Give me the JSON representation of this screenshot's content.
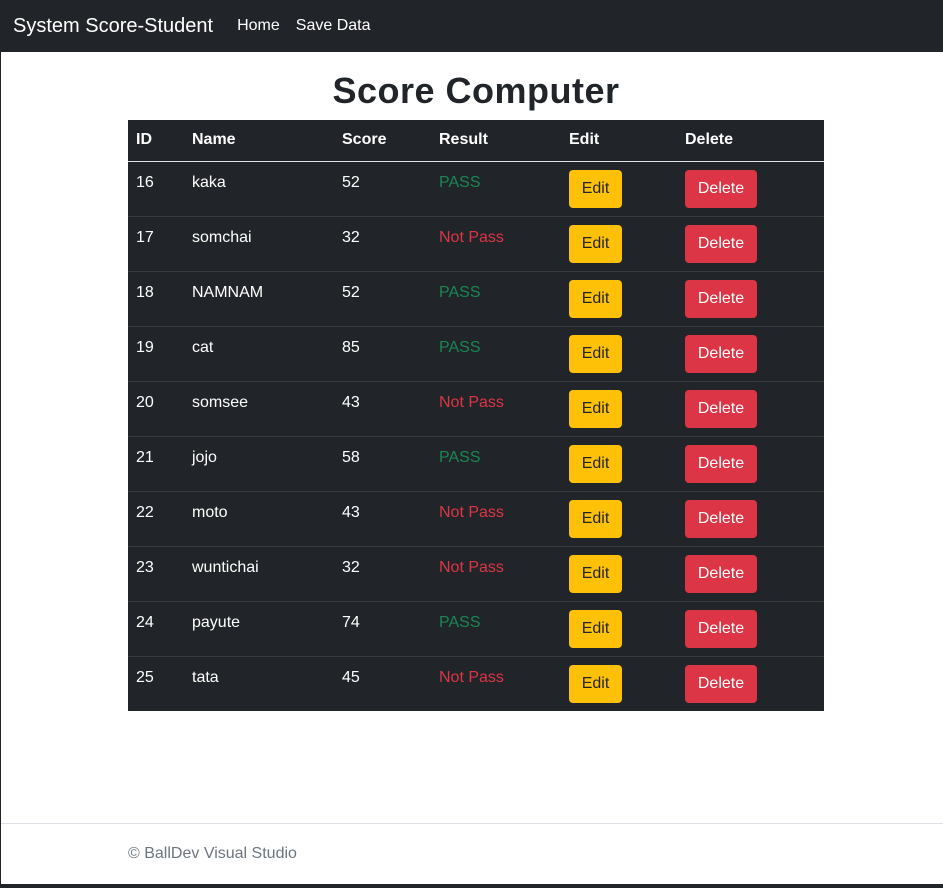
{
  "navbar": {
    "brand": "System Score-Student",
    "links": [
      "Home",
      "Save Data"
    ]
  },
  "page_title": "Score Computer",
  "table": {
    "headers": [
      "ID",
      "Name",
      "Score",
      "Result",
      "Edit",
      "Delete"
    ],
    "rows": [
      {
        "id": "16",
        "name": "kaka",
        "score": "52",
        "result": "PASS",
        "pass": true
      },
      {
        "id": "17",
        "name": "somchai",
        "score": "32",
        "result": "Not Pass",
        "pass": false
      },
      {
        "id": "18",
        "name": "NAMNAM",
        "score": "52",
        "result": "PASS",
        "pass": true
      },
      {
        "id": "19",
        "name": "cat",
        "score": "85",
        "result": "PASS",
        "pass": true
      },
      {
        "id": "20",
        "name": "somsee",
        "score": "43",
        "result": "Not Pass",
        "pass": false
      },
      {
        "id": "21",
        "name": "jojo",
        "score": "58",
        "result": "PASS",
        "pass": true
      },
      {
        "id": "22",
        "name": "moto",
        "score": "43",
        "result": "Not Pass",
        "pass": false
      },
      {
        "id": "23",
        "name": "wuntichai",
        "score": "32",
        "result": "Not Pass",
        "pass": false
      },
      {
        "id": "24",
        "name": "payute",
        "score": "74",
        "result": "PASS",
        "pass": true
      },
      {
        "id": "25",
        "name": "tata",
        "score": "45",
        "result": "Not Pass",
        "pass": false
      }
    ],
    "edit_label": "Edit",
    "delete_label": "Delete"
  },
  "footer": {
    "text": "© BallDev Visual Studio"
  },
  "colors": {
    "navbar_bg": "#212529",
    "pass": "#198754",
    "fail": "#dc3545",
    "edit_button": "#ffc107",
    "delete_button": "#dc3545"
  }
}
